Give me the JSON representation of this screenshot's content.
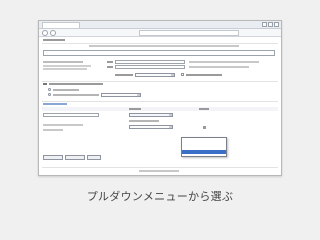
{
  "caption": "プルダウンメニューから選ぶ"
}
